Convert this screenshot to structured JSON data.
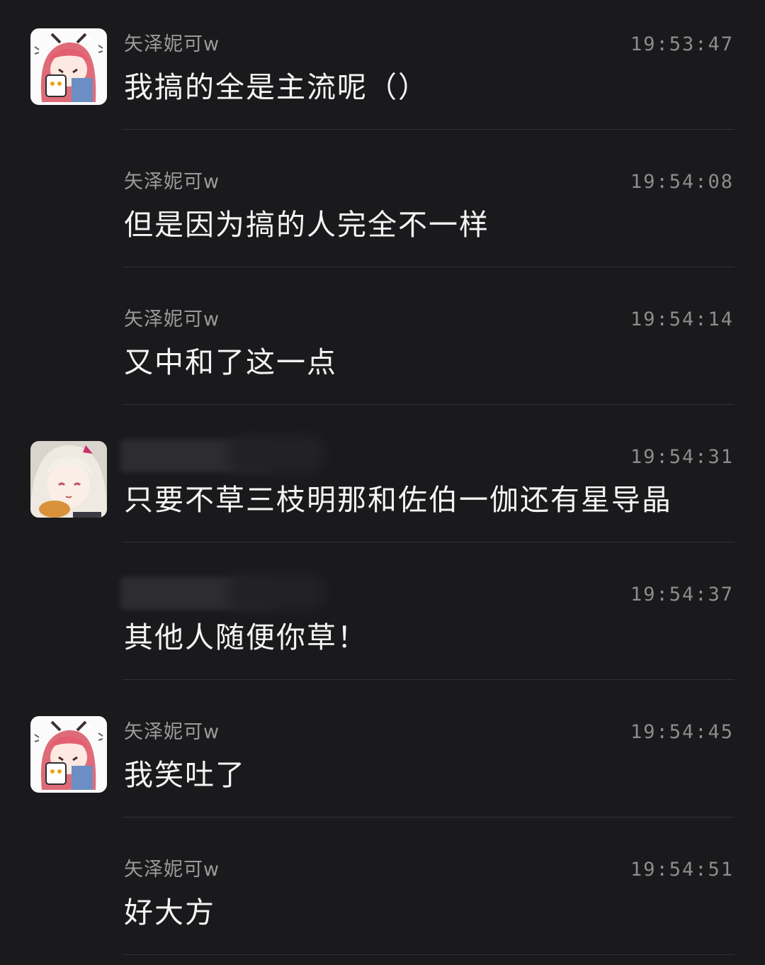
{
  "messages": [
    {
      "sender": "矢泽妮可w",
      "time": "19:53:47",
      "text": "我搞的全是主流呢（）",
      "avatar": "pink-haired-character-avatar",
      "sender_hidden": false
    },
    {
      "sender": "矢泽妮可w",
      "time": "19:54:08",
      "text": "但是因为搞的人完全不一样",
      "avatar": null,
      "sender_hidden": false
    },
    {
      "sender": "矢泽妮可w",
      "time": "19:54:14",
      "text": "又中和了这一点",
      "avatar": null,
      "sender_hidden": false
    },
    {
      "sender": "",
      "time": "19:54:31",
      "text": "只要不草三枝明那和佐伯一伽还有星导晶",
      "avatar": "white-haired-character-avatar",
      "sender_hidden": true
    },
    {
      "sender": "",
      "time": "19:54:37",
      "text": "其他人随便你草！",
      "avatar": null,
      "sender_hidden": true
    },
    {
      "sender": "矢泽妮可w",
      "time": "19:54:45",
      "text": "我笑吐了",
      "avatar": "pink-haired-character-avatar",
      "sender_hidden": false
    },
    {
      "sender": "矢泽妮可w",
      "time": "19:54:51",
      "text": "好大方",
      "avatar": null,
      "sender_hidden": false
    }
  ],
  "colors": {
    "background": "#1a1a1c",
    "message_text": "#f4f4f4",
    "sender_text": "#9a9a9a",
    "time_text": "#8d8d8d",
    "divider": "#323236"
  }
}
